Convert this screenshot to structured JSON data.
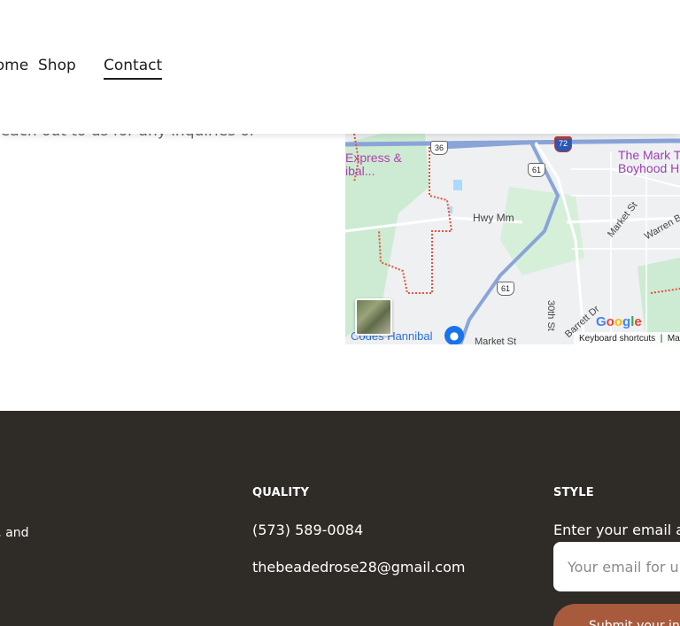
{
  "nav": {
    "home_label": "Home",
    "shop_label": "Shop",
    "contact_label": "Contact"
  },
  "intro_text": "reach out to us for any inquiries or",
  "map": {
    "poi_express": "Express &",
    "poi_express_2": "ibal...",
    "poi_mark_twain": "The Mark T",
    "poi_mark_twain_2": "Boyhood Ho",
    "road_hwy_mm": "Hwy Mm",
    "road_market_st": "Market St",
    "road_warren": "Warren B",
    "road_30th": "30th St",
    "road_barrett": "Barrett Dr",
    "poi_codes": "Codes Hannibal",
    "road_market_st_2": "Market St",
    "shield_36": "36",
    "shield_61a": "61",
    "shield_61b": "61",
    "shield_72": "72",
    "google_logo": "Google",
    "keyboard_shortcuts": "Keyboard shortcuts",
    "map_data": "Map",
    "colors": {
      "water": "#aadaff",
      "park": "#cdebd2",
      "road": "#ffffff",
      "highway": "#8aa4d8",
      "boundary": "#e0533e"
    }
  },
  "footer": {
    "blurb": "s, and",
    "heading_quality": "QUALITY",
    "heading_style": "STYLE",
    "phone": "(573) 589-0084",
    "email": "thebeadedrose28@gmail.com",
    "newsletter_label": "Enter your email a",
    "newsletter_placeholder": "Your email for u",
    "submit_label": "Submit your in"
  },
  "colors": {
    "footer_bg": "#2f2b27",
    "button_bg": "#a85a3d",
    "text_dark": "#1c1c1c"
  }
}
